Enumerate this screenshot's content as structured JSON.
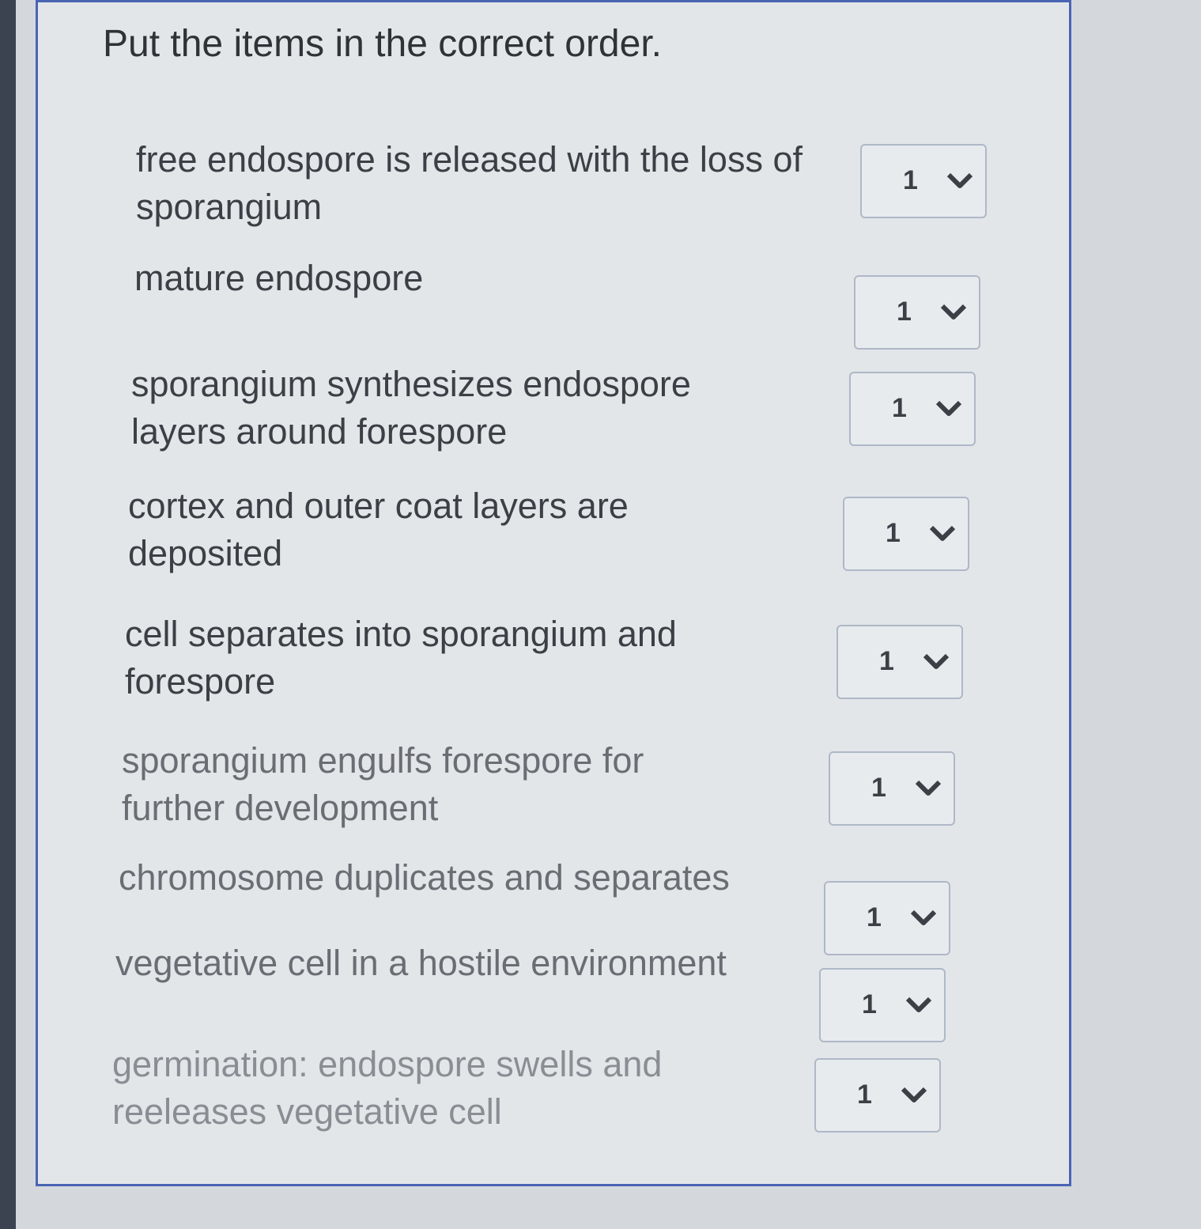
{
  "question": {
    "prompt": "Put the items in the correct order."
  },
  "items": [
    {
      "text": "free endospore is released with the loss of sporangium",
      "selected": "1"
    },
    {
      "text": "mature endospore",
      "selected": "1"
    },
    {
      "text": "sporangium synthesizes endospore layers around forespore",
      "selected": "1"
    },
    {
      "text": "cortex and outer coat layers are deposited",
      "selected": "1"
    },
    {
      "text": "cell separates into sporangium and forespore",
      "selected": "1"
    },
    {
      "text": "sporangium engulfs forespore for further development",
      "selected": "1"
    },
    {
      "text": "chromosome duplicates and separates",
      "selected": "1"
    },
    {
      "text": "vegetative cell in a hostile environment",
      "selected": "1"
    },
    {
      "text": "germination: endospore swells and reeleases vegetative cell",
      "selected": "1"
    }
  ],
  "icons": {
    "dropdown": "chevron-down-icon"
  },
  "colors": {
    "panel_border": "#4a64b4",
    "select_border": "#aeb8c6"
  }
}
